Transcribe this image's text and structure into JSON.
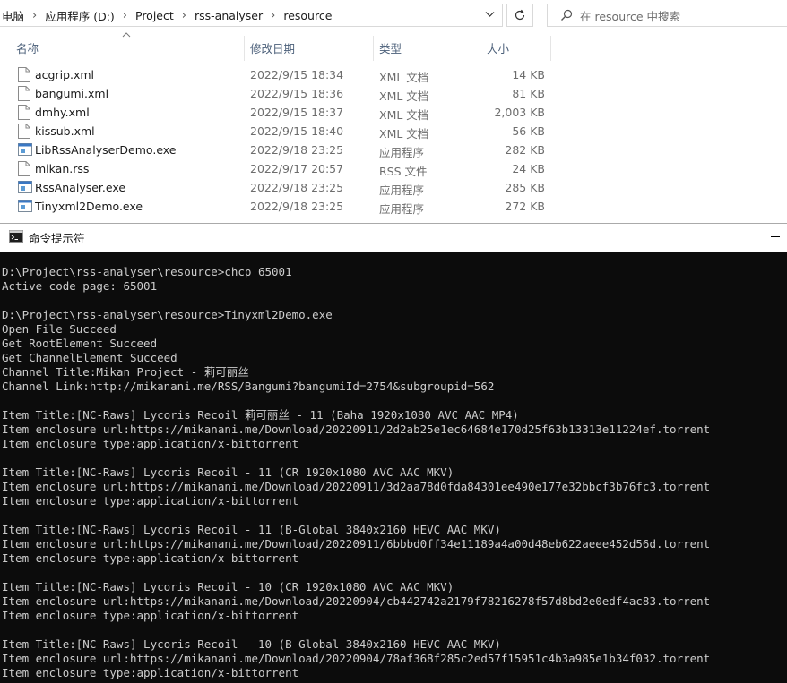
{
  "explorer": {
    "breadcrumb": [
      "电脑",
      "应用程序 (D:)",
      "Project",
      "rss-analyser",
      "resource"
    ],
    "search_placeholder": "在 resource 中搜索",
    "columns": {
      "name": "名称",
      "date": "修改日期",
      "type": "类型",
      "size": "大小"
    },
    "files": [
      {
        "name": "acgrip.xml",
        "date": "2022/9/15 18:34",
        "type": "XML 文档",
        "size": "14 KB",
        "icon": "document-icon"
      },
      {
        "name": "bangumi.xml",
        "date": "2022/9/15 18:36",
        "type": "XML 文档",
        "size": "81 KB",
        "icon": "document-icon"
      },
      {
        "name": "dmhy.xml",
        "date": "2022/9/15 18:37",
        "type": "XML 文档",
        "size": "2,003 KB",
        "icon": "document-icon"
      },
      {
        "name": "kissub.xml",
        "date": "2022/9/15 18:40",
        "type": "XML 文档",
        "size": "56 KB",
        "icon": "document-icon"
      },
      {
        "name": "LibRssAnalyserDemo.exe",
        "date": "2022/9/18 23:25",
        "type": "应用程序",
        "size": "282 KB",
        "icon": "exe-icon"
      },
      {
        "name": "mikan.rss",
        "date": "2022/9/17 20:57",
        "type": "RSS 文件",
        "size": "24 KB",
        "icon": "document-icon"
      },
      {
        "name": "RssAnalyser.exe",
        "date": "2022/9/18 23:25",
        "type": "应用程序",
        "size": "285 KB",
        "icon": "exe-icon"
      },
      {
        "name": "Tinyxml2Demo.exe",
        "date": "2022/9/18 23:25",
        "type": "应用程序",
        "size": "272 KB",
        "icon": "exe-icon"
      }
    ]
  },
  "cmd": {
    "title": "命令提示符",
    "lines": [
      "D:\\Project\\rss-analyser\\resource>chcp 65001",
      "Active code page: 65001",
      "",
      "D:\\Project\\rss-analyser\\resource>Tinyxml2Demo.exe",
      "Open File Succeed",
      "Get RootElement Succeed",
      "Get ChannelElement Succeed",
      "Channel Title:Mikan Project - 莉可丽丝",
      "Channel Link:http://mikanani.me/RSS/Bangumi?bangumiId=2754&subgroupid=562",
      "",
      "Item Title:[NC-Raws] Lycoris Recoil 莉可丽丝 - 11 (Baha 1920x1080 AVC AAC MP4)",
      "Item enclosure url:https://mikanani.me/Download/20220911/2d2ab25e1ec64684e170d25f63b13313e11224ef.torrent",
      "Item enclosure type:application/x-bittorrent",
      "",
      "Item Title:[NC-Raws] Lycoris Recoil - 11 (CR 1920x1080 AVC AAC MKV)",
      "Item enclosure url:https://mikanani.me/Download/20220911/3d2aa78d0fda84301ee490e177e32bbcf3b76fc3.torrent",
      "Item enclosure type:application/x-bittorrent",
      "",
      "Item Title:[NC-Raws] Lycoris Recoil - 11 (B-Global 3840x2160 HEVC AAC MKV)",
      "Item enclosure url:https://mikanani.me/Download/20220911/6bbbd0ff34e11189a4a00d48eb622aeee452d56d.torrent",
      "Item enclosure type:application/x-bittorrent",
      "",
      "Item Title:[NC-Raws] Lycoris Recoil - 10 (CR 1920x1080 AVC AAC MKV)",
      "Item enclosure url:https://mikanani.me/Download/20220904/cb442742a2179f78216278f57d8bd2e0edf4ac83.torrent",
      "Item enclosure type:application/x-bittorrent",
      "",
      "Item Title:[NC-Raws] Lycoris Recoil - 10 (B-Global 3840x2160 HEVC AAC MKV)",
      "Item enclosure url:https://mikanani.me/Download/20220904/78af368f285c2ed57f15951c4b3a985e1b34f032.torrent",
      "Item enclosure type:application/x-bittorrent"
    ]
  }
}
